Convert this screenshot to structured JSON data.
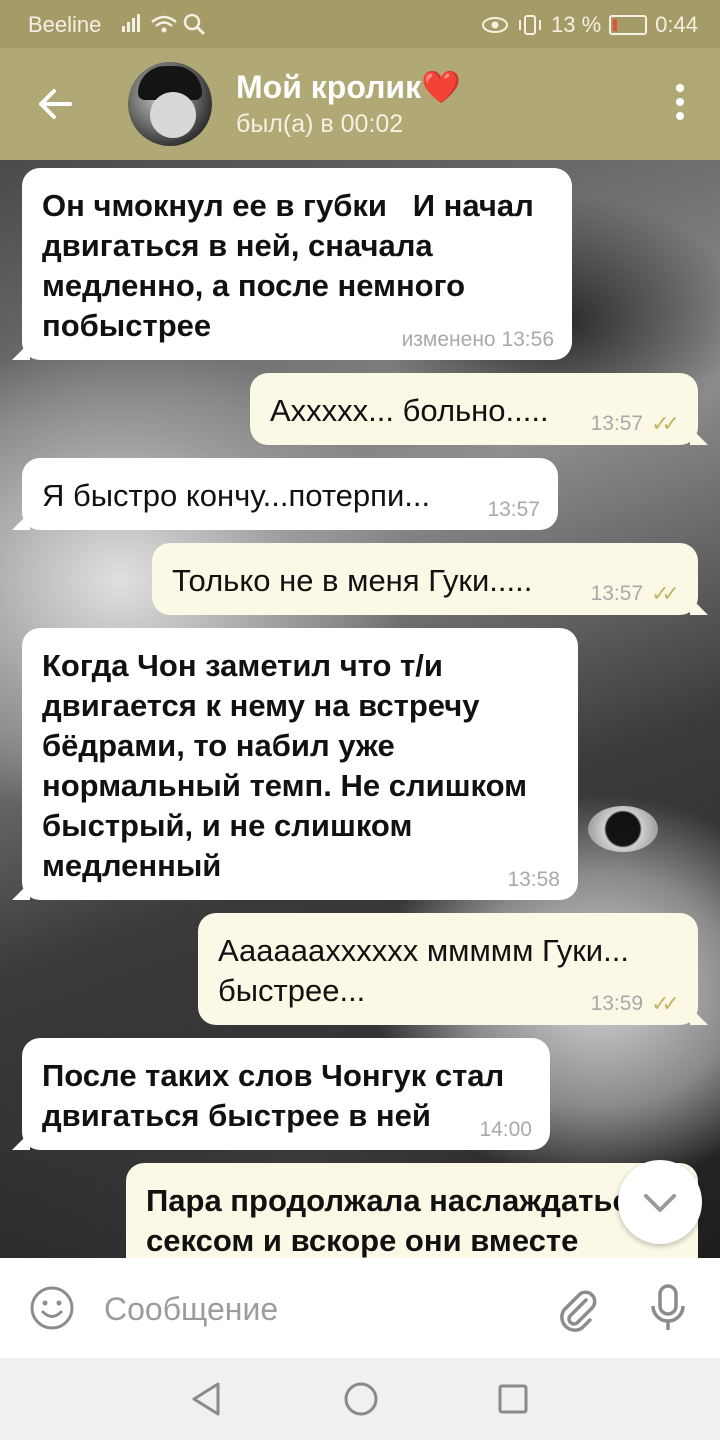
{
  "status_bar": {
    "carrier": "Beeline",
    "battery": "13 %",
    "time": "0:44"
  },
  "header": {
    "title": "Мой кролик",
    "title_emoji": "❤️",
    "status": "был(а) в 00:02",
    "icons": [
      "back-arrow-icon",
      "more-vert-icon"
    ]
  },
  "messages": [
    {
      "direction": "in",
      "bold": true,
      "text": "Он чмокнул ее в губки   И начал двигаться в ней, сначала медленно, а после немного побыстрее",
      "meta": "изменено 13:56"
    },
    {
      "direction": "out",
      "bold": false,
      "text": "Аххххх... больно.....",
      "meta": "13:57",
      "read": true
    },
    {
      "direction": "in",
      "bold": false,
      "text": "Я быстро кончу...потерпи...",
      "meta": "13:57"
    },
    {
      "direction": "out",
      "bold": false,
      "text": "Только не в меня Гуки.....",
      "meta": "13:57",
      "read": true
    },
    {
      "direction": "in",
      "bold": true,
      "text": "Когда Чон заметил что т/и двигается к нему на встречу бёдрами, то набил уже нормальный темп. Не слишком быстрый, и не слишком медленный",
      "meta": "13:58"
    },
    {
      "direction": "out",
      "bold": false,
      "text": "Ааааааххххxх ммммм Гуки... быстрее...",
      "meta": "13:59",
      "read": true
    },
    {
      "direction": "in",
      "bold": true,
      "text": "После таких слов Чонгук стал двигаться быстрее в ней",
      "meta": "14:00"
    },
    {
      "direction": "out",
      "bold": true,
      "text": "Пара продолжала наслаждаться сексом и вскоре они вместе",
      "meta": ""
    }
  ],
  "input": {
    "placeholder": "Сообщение"
  },
  "colors": {
    "header": "#b0a875",
    "status_bar": "#a49b66",
    "incoming_bubble": "#ffffff",
    "outgoing_bubble": "#fbf8e6",
    "read_ticks": "#c2b869"
  }
}
